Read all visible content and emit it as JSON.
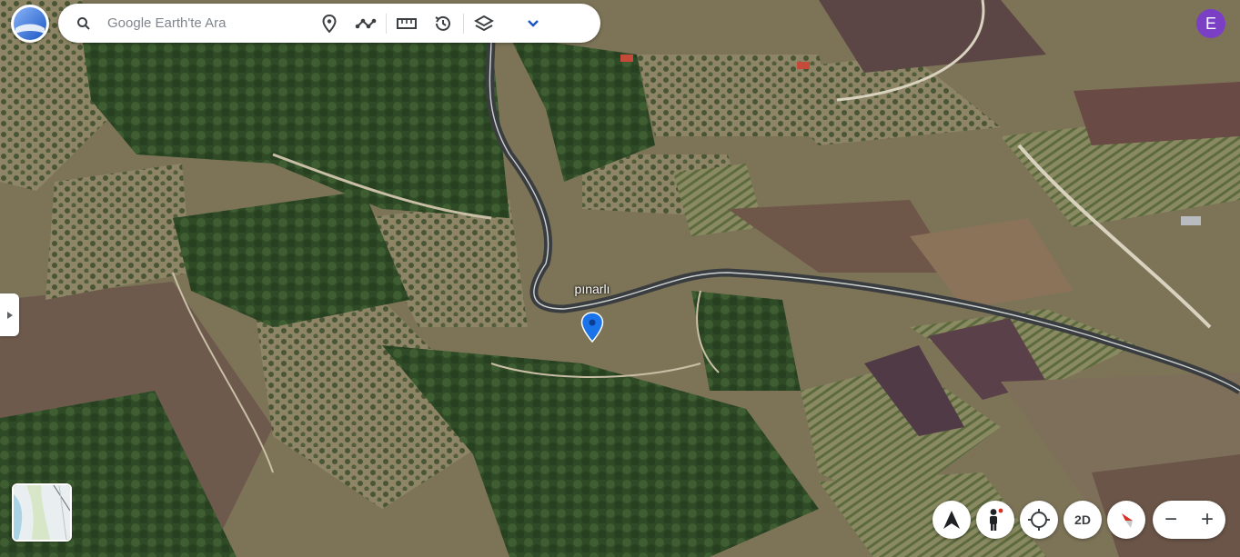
{
  "search": {
    "placeholder": "Google Earth'te Ara"
  },
  "toolbar": {
    "icons": [
      "search-icon",
      "place-pin-icon",
      "path-icon",
      "ruler-icon",
      "history-icon",
      "layers-icon",
      "chevron-down-icon"
    ]
  },
  "map": {
    "place_label": "pınarlı"
  },
  "account": {
    "avatar_letter": "E"
  },
  "controls": {
    "mode_label": "2D",
    "zoom_out_label": "−",
    "zoom_in_label": "+"
  },
  "colors": {
    "accent": "#1a73e8",
    "avatar": "#7b3fc6",
    "pin": "#1a73e8"
  }
}
